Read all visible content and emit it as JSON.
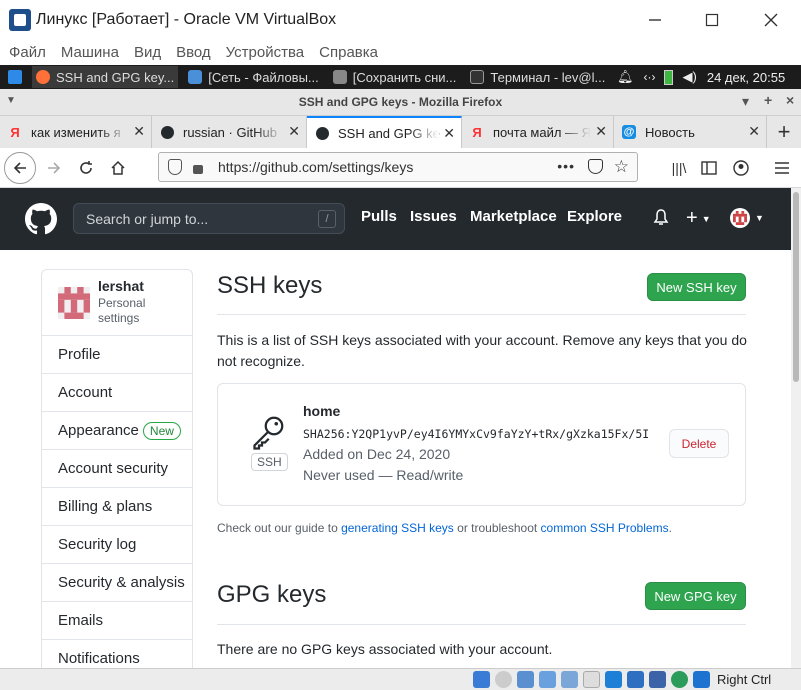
{
  "vbox": {
    "title": "Линукс [Работает] - Oracle VM VirtualBox",
    "menu": [
      "Файл",
      "Машина",
      "Вид",
      "Ввод",
      "Устройства",
      "Справка"
    ],
    "host_key": "Right Ctrl"
  },
  "taskbar": {
    "items": [
      "SSH and GPG key...",
      "[Сеть - Файловы...",
      "[Сохранить сни...",
      "Терминал - lev@l..."
    ],
    "clock": "24 дек, 20:55"
  },
  "firefox": {
    "window_title": "SSH and GPG keys - Mozilla Firefox",
    "tabs": [
      "как изменить я",
      "russian · GitHub",
      "SSH and GPG ke",
      "почта майл — Я",
      "Новость"
    ],
    "url": "https://github.com/settings/keys"
  },
  "github": {
    "search_placeholder": "Search or jump to...",
    "search_key": "/",
    "nav": [
      "Pulls",
      "Issues",
      "Marketplace",
      "Explore"
    ],
    "user": {
      "name": "lershat",
      "sub1": "Personal",
      "sub2": "settings"
    },
    "sidebar": [
      "Profile",
      "Account",
      "Appearance",
      "Account security",
      "Billing & plans",
      "Security log",
      "Security & analysis",
      "Emails",
      "Notifications"
    ],
    "appearance_badge": "New",
    "ssh": {
      "title": "SSH keys",
      "new_button": "New SSH key",
      "desc": "This is a list of SSH keys associated with your account. Remove any keys that you do not recognize.",
      "key": {
        "name": "home",
        "type": "SSH",
        "fingerprint": "SHA256:Y2QP1yvP/ey4I6YMYxCv9faYzY+tRx/gXzka15Fx/5I",
        "added": "Added on Dec 24, 2020",
        "usage": "Never used — Read/write",
        "delete": "Delete"
      },
      "guide_pre": "Check out our guide to ",
      "guide_link1": "generating SSH keys",
      "guide_mid": " or troubleshoot ",
      "guide_link2": "common SSH Problems",
      "guide_post": "."
    },
    "gpg": {
      "title": "GPG keys",
      "new_button": "New GPG key",
      "empty": "There are no GPG keys associated with your account."
    }
  },
  "colors": {
    "github_header": "#24292e",
    "green_button": "#2ea44f",
    "link": "#0366d6",
    "firefox_accent": "#0a84ff"
  }
}
